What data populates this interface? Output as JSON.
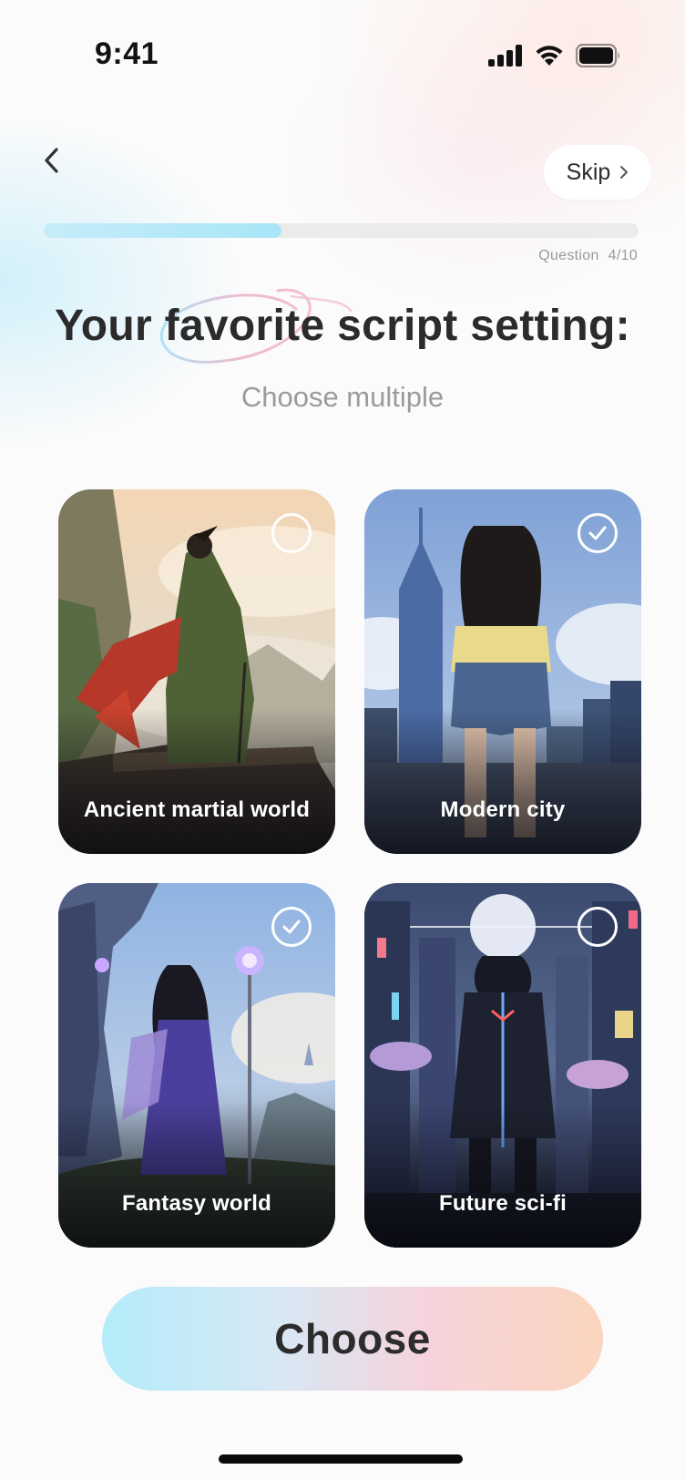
{
  "status_bar": {
    "time": "9:41",
    "icons": [
      "cellular-signal-icon",
      "wifi-icon",
      "battery-icon"
    ]
  },
  "nav": {
    "back_icon": "chevron-left-icon",
    "skip_label": "Skip",
    "skip_icon": "chevron-right-icon"
  },
  "progress": {
    "fraction": 0.4,
    "question_label": "Question",
    "question_count": "4/10"
  },
  "title": "Your favorite script setting:",
  "subtitle": "Choose multiple",
  "options": [
    {
      "label": "Ancient martial world",
      "selected": false
    },
    {
      "label": "Modern city",
      "selected": true
    },
    {
      "label": "Fantasy world",
      "selected": true
    },
    {
      "label": "Future sci-fi",
      "selected": false
    }
  ],
  "choose_label": "Choose",
  "colors": {
    "progress_fill": "#a8e6f8",
    "progress_track": "#ebebeb",
    "button_gradient": [
      "#b4ecfa",
      "#f6d3dc",
      "#fbd5bd"
    ],
    "text_primary": "#2b2b2b",
    "text_muted": "#9b9b9b"
  }
}
